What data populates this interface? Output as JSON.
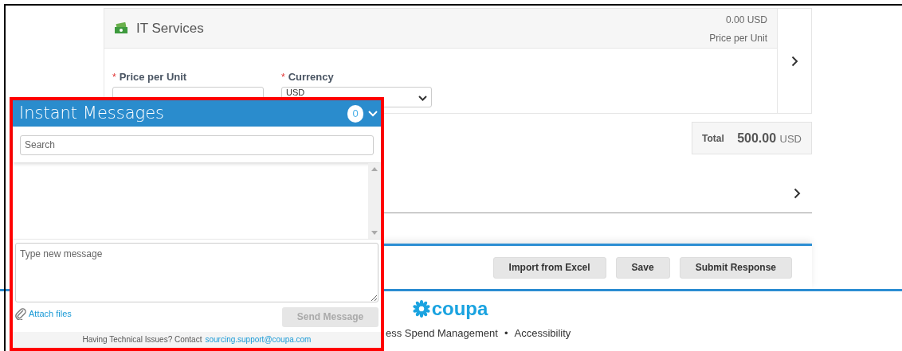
{
  "line_item": {
    "title": "IT Services",
    "amount": "0.00 USD",
    "amount_label": "Price per Unit",
    "fields": [
      {
        "label": "Price per Unit",
        "required_mark": "*",
        "kind": "input"
      },
      {
        "label": "Currency",
        "required_mark": "*",
        "kind": "select",
        "value": "USD"
      }
    ]
  },
  "total": {
    "label": "Total",
    "value": "500.00",
    "currency": "USD"
  },
  "actions": [
    "Import from Excel",
    "Save",
    "Submit Response"
  ],
  "footer": {
    "logo": "coupa",
    "links": [
      "ess Spend Management",
      "•",
      "Accessibility"
    ]
  },
  "chat": {
    "title": "Instant Messages",
    "unread": "0",
    "search": {
      "placeholder": "Search"
    },
    "message": {
      "placeholder": "Type new message"
    },
    "attach": "Attach files",
    "send": {
      "label": "Send Message",
      "disabled": true
    },
    "help": "Having Technical Issues? Contact",
    "email": "sourcing.support@coupa.com"
  }
}
